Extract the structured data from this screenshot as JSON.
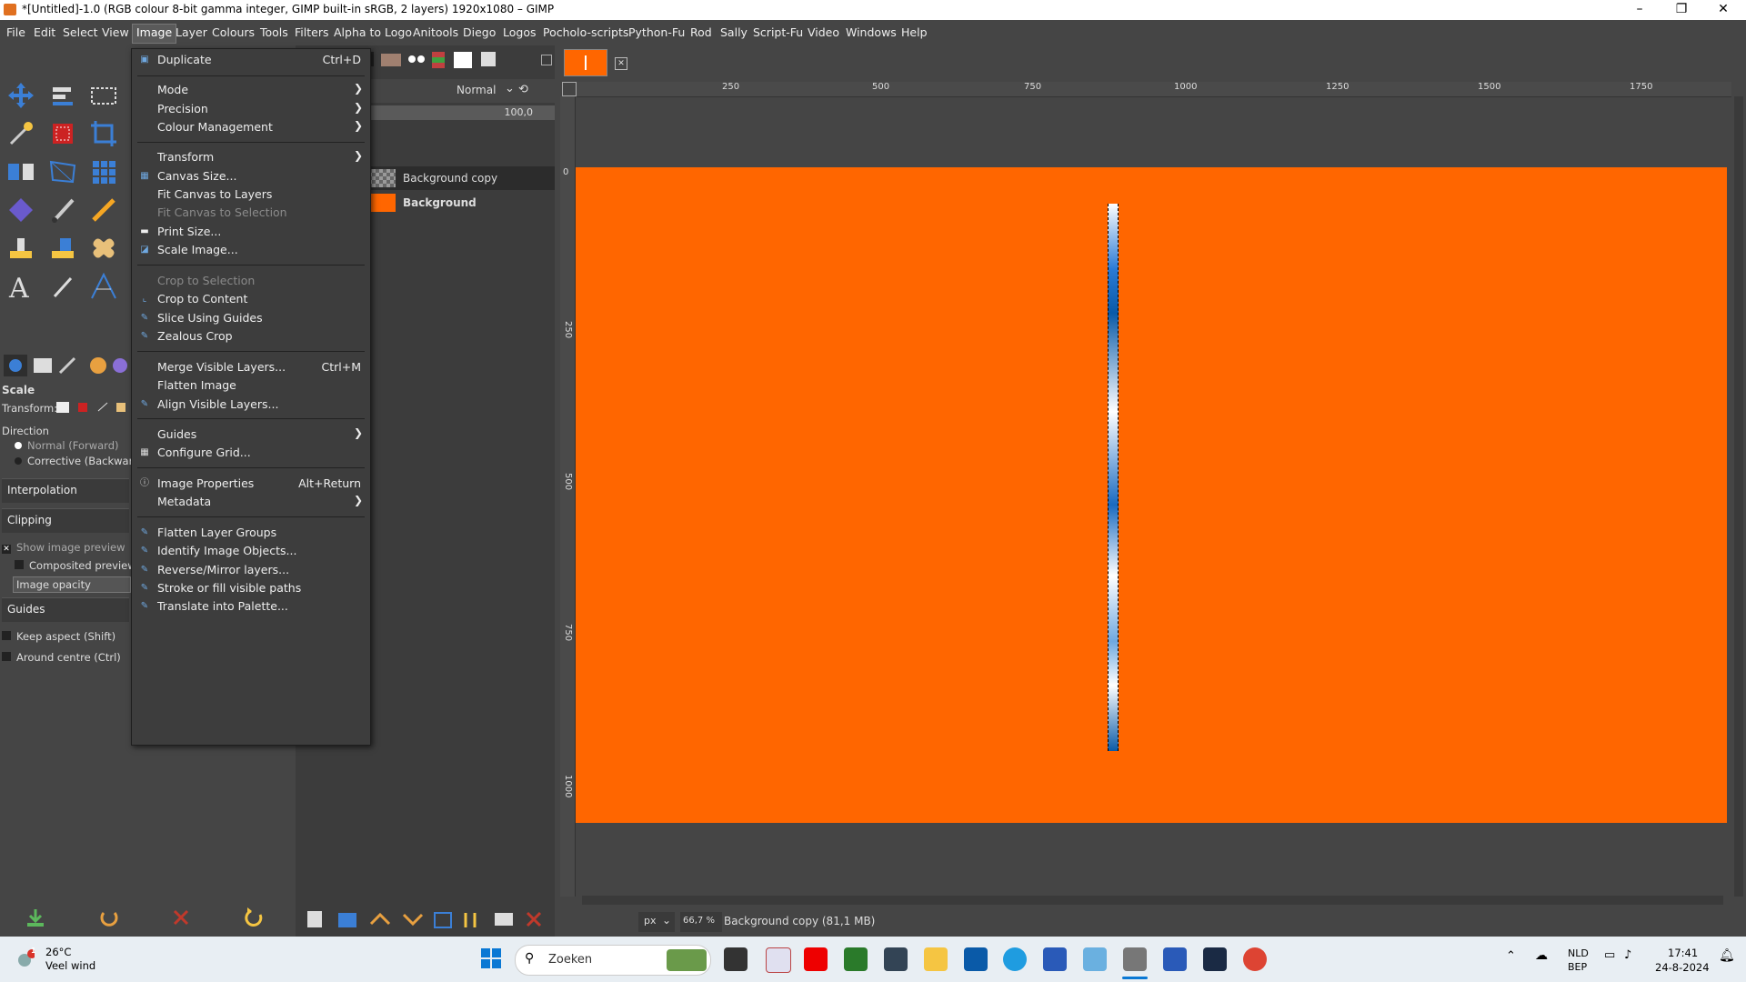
{
  "window": {
    "title": "*[Untitled]-1.0 (RGB colour 8-bit gamma integer, GIMP built-in sRGB, 2 layers) 1920x1080 – GIMP",
    "min_glyph": "–",
    "max_glyph": "❐",
    "close_glyph": "✕"
  },
  "menubar": [
    "File",
    "Edit",
    "Select",
    "View",
    "Image",
    "Layer",
    "Colours",
    "Tools",
    "Filters",
    "Alpha to Logo",
    "Anitools",
    "Diego",
    "Logos",
    "Pocholo-scripts",
    "Python-Fu",
    "Rod",
    "Sally",
    "Script-Fu",
    "Video",
    "Windows",
    "Help"
  ],
  "image_menu": {
    "duplicate": {
      "label": "Duplicate",
      "shortcut": "Ctrl+D"
    },
    "mode": "Mode",
    "precision": "Precision",
    "colour_management": "Colour Management",
    "transform": "Transform",
    "canvas_size": "Canvas Size...",
    "fit_canvas_layers": "Fit Canvas to Layers",
    "fit_canvas_selection": "Fit Canvas to Selection",
    "print_size": "Print Size...",
    "scale_image": "Scale Image...",
    "crop_selection": "Crop to Selection",
    "crop_content": "Crop to Content",
    "slice_guides": "Slice Using Guides",
    "zealous_crop": "Zealous Crop",
    "merge_visible": {
      "label": "Merge Visible Layers...",
      "shortcut": "Ctrl+M"
    },
    "flatten_image": "Flatten Image",
    "align_visible": "Align Visible Layers...",
    "guides": "Guides",
    "configure_grid": "Configure Grid...",
    "image_properties": {
      "label": "Image Properties",
      "shortcut": "Alt+Return"
    },
    "metadata": "Metadata",
    "flatten_layer_groups": "Flatten Layer Groups",
    "identify_objects": "Identify Image Objects...",
    "reverse_mirror": "Reverse/Mirror layers...",
    "stroke_fill_paths": "Stroke or fill visible paths",
    "translate_palette": "Translate into Palette..."
  },
  "tool_options": {
    "tool_name": "Scale",
    "transform_label": "Transform:",
    "direction_label": "Direction",
    "normal": "Normal (Forward)",
    "corrective": "Corrective (Backward)",
    "interpolation": "Interpolation",
    "clipping": "Clipping",
    "show_preview": "Show image preview",
    "composited_preview": "Composited preview",
    "image_opacity": "Image opacity",
    "guides": "Guides",
    "keep_aspect": "Keep aspect (Shift)",
    "around_centre": "Around centre (Ctrl)"
  },
  "layers_panel": {
    "mode": "Normal",
    "opacity": "100,0",
    "layers": [
      "Background copy",
      "Background"
    ]
  },
  "rulers": {
    "h": [
      "250",
      "500",
      "750",
      "1000",
      "1250",
      "1500",
      "1750"
    ],
    "v": [
      "0",
      "250",
      "500",
      "750",
      "1000"
    ]
  },
  "statusbar": {
    "unit": "px",
    "zoom": "66,7 %",
    "info": "Background copy (81,1 MB)"
  },
  "taskbar": {
    "temp": "26°C",
    "weather": "Veel wind",
    "search": "Zoeken",
    "lang1": "NLD",
    "lang2": "BEP",
    "time": "17:41",
    "date": "24-8-2024",
    "notif": "1"
  },
  "colors": {
    "image_bg": "#ff6600",
    "ui_bg": "#454545",
    "menu_bg": "#3d3d3d"
  }
}
